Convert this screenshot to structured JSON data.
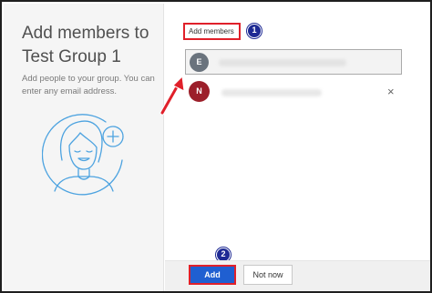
{
  "dialog": {
    "title": "Add members to Test Group 1",
    "description": "Add people to your group. You can enter any email address."
  },
  "field": {
    "label": "Add members"
  },
  "members": [
    {
      "initial": "E",
      "avatar_color": "#6a737d",
      "selected": true
    },
    {
      "initial": "N",
      "avatar_color": "#9c1f2a",
      "selected": false
    }
  ],
  "remove_icon": "×",
  "buttons": {
    "add": "Add",
    "not_now": "Not now"
  },
  "annotations": {
    "step1": "1",
    "step2": "2",
    "highlight_color": "#e0202a",
    "badge_color": "#1e2a94"
  }
}
